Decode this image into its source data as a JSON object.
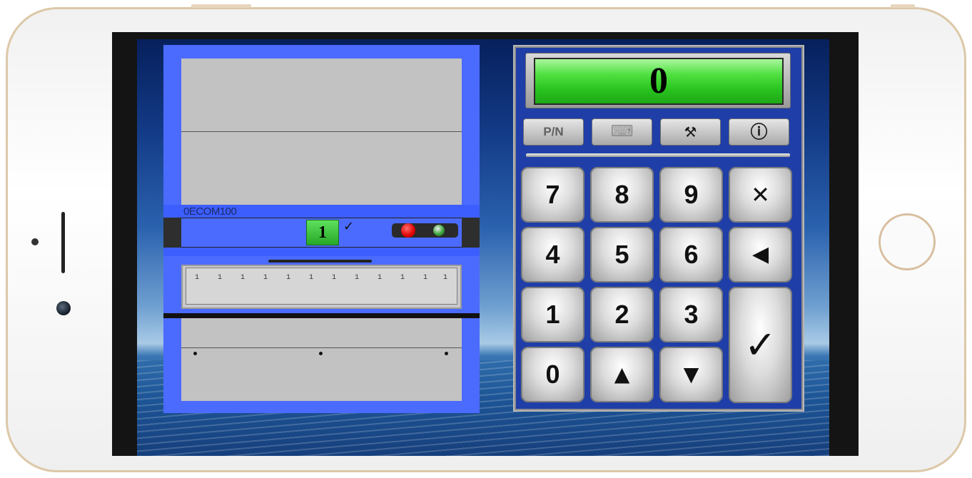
{
  "cabinet": {
    "bay_label": "0ECOM100",
    "quantity": "1",
    "check": "✓",
    "ruler_ticks": [
      "1",
      "1",
      "1",
      "1",
      "1",
      "1",
      "1",
      "1",
      "1",
      "1",
      "1",
      "1"
    ]
  },
  "keypad": {
    "display_value": "0",
    "function_buttons": [
      {
        "label": "P/N",
        "name": "pn-button"
      },
      {
        "label": "⌨",
        "name": "keyboard-icon-button"
      },
      {
        "label": "⚒",
        "name": "tools-icon-button"
      },
      {
        "label": "ⓘ",
        "name": "info-icon-button"
      }
    ],
    "keys": {
      "k7": "7",
      "k8": "8",
      "k9": "9",
      "clear": "✕",
      "k4": "4",
      "k5": "5",
      "k6": "6",
      "back": "◀",
      "k1": "1",
      "k2": "2",
      "k3": "3",
      "enter": "✓",
      "k0": "0",
      "up": "▲",
      "down": "▼"
    }
  },
  "colors": {
    "cabinet_blue": "#4b6bff",
    "display_green": "#28c21e",
    "panel_blue": "#1f3ea8"
  }
}
